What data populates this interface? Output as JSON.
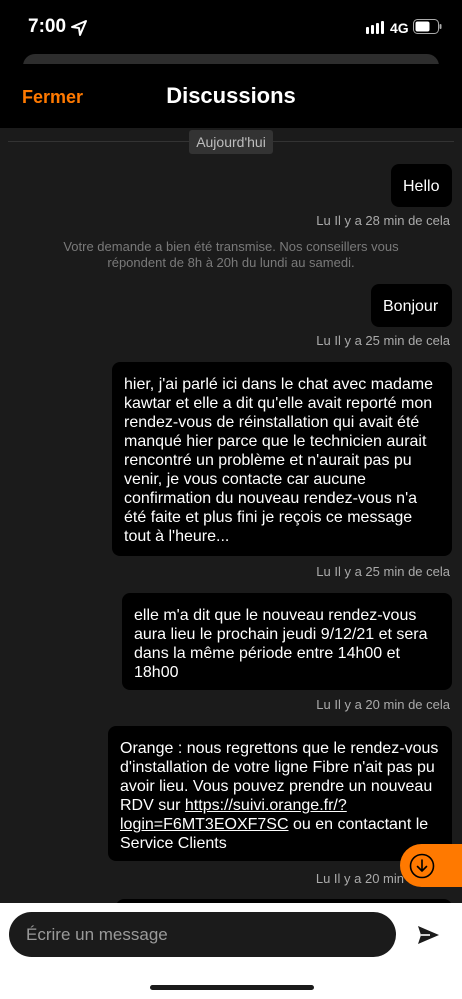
{
  "status_bar": {
    "time": "7:00",
    "network": "4G",
    "icons": [
      "location-arrow-icon",
      "signal-bars-icon",
      "battery-icon"
    ]
  },
  "header": {
    "close_label": "Fermer",
    "title": "Discussions"
  },
  "chat": {
    "day_separator": "Aujourd'hui",
    "messages": [
      {
        "text": "Hello",
        "meta": "Lu  Il y a 28 min de cela"
      },
      {
        "text": "Bonjour",
        "meta": "Lu  Il y a 25 min de cela"
      },
      {
        "text": "hier, j'ai parlé ici dans le chat avec madame kawtar et elle a dit qu'elle avait reporté mon rendez-vous de réinstallation qui avait été manqué hier parce que le technicien aurait rencontré un problème et n'aurait pas pu venir, je vous contacte car aucune confirmation du nouveau rendez-vous n'a été faite et plus  fini je reçois ce message tout à l'heure...",
        "meta": "Lu  Il y a 25 min de cela"
      },
      {
        "text": "elle m'a dit que le nouveau rendez-vous aura lieu le prochain jeudi 9/12/21 et sera dans la même période entre 14h00 et 18h00",
        "meta": "Lu  Il y a 20 min de cela"
      },
      {
        "text_before": "Orange : nous regrettons que le rendez-vous d'installation de votre ligne Fibre n'ait pas pu avoir lieu. Vous pouvez prendre un nouveau RDV sur ",
        "link": "https://suivi.orange.fr/?login=F6MT3EOXF7SC",
        "text_after": " ou en contactant le Service Clients",
        "meta": "Lu  Il y a 20 min"
      }
    ],
    "system_note": "Votre demande a bien été transmise. Nos conseillers vous répondent de 8h à 20h du lundi au samedi."
  },
  "composer": {
    "placeholder": "Écrire un message",
    "send_icon": "send-icon"
  },
  "colors": {
    "accent": "#ff7900",
    "chat_background": "#1b1b1b",
    "bubble": "#000000"
  }
}
